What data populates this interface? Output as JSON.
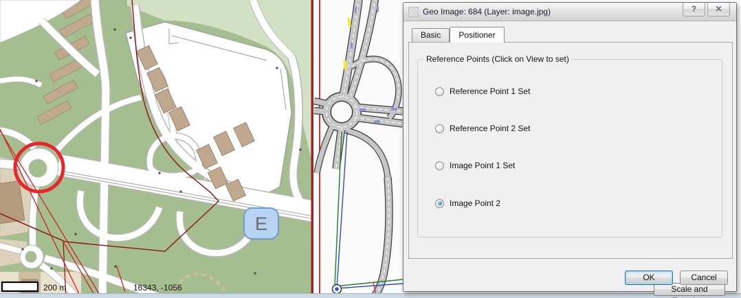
{
  "window": {
    "title": "Geo Image: 684 (Layer: image.jpg)",
    "help_glyph": "?",
    "close_glyph": "✕"
  },
  "dialog": {
    "tabs": [
      {
        "label": "Basic",
        "active": false
      },
      {
        "label": "Positioner",
        "active": true
      }
    ],
    "group_title": "Reference Points (Click on View to set)",
    "radios": [
      {
        "label": "Reference Point 1 Set",
        "selected": false
      },
      {
        "label": "Reference Point 2 Set",
        "selected": false
      },
      {
        "label": "Image Point 1 Set",
        "selected": false
      },
      {
        "label": "Image Point 2",
        "selected": true
      }
    ],
    "buttons": {
      "scale_translate": "Scale and Translate",
      "ok": "OK",
      "cancel": "Cancel"
    }
  },
  "map": {
    "scale_label": "200 m",
    "coordinates": "16343, -1056",
    "marker_label": "E"
  },
  "colors": {
    "map_green": "#a4be90",
    "map_light_green": "#d2e0c4",
    "building_tan": "#bfa88d",
    "highlight_red": "#e8252b",
    "boundary_maroon": "#8e1b1b",
    "image_border_red": "#c0392b",
    "ref_line_green": "#1e7d1e",
    "ref_line_blue": "#2b47cf",
    "marker_badge_blue": "#b7d3f2",
    "dialog_bg": "#f0f0f0",
    "default_button_border": "#3c7fb1",
    "bottom_strip": "#ccdae6"
  }
}
